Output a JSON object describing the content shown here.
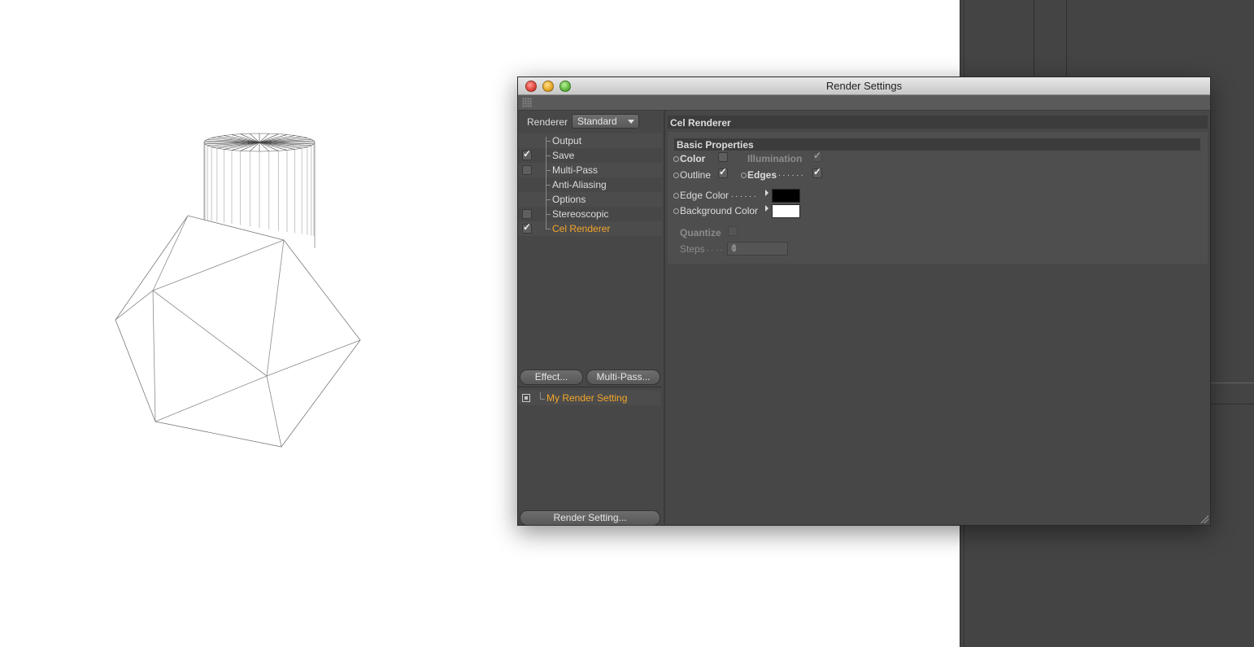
{
  "window": {
    "title": "Render Settings"
  },
  "sidebar": {
    "renderer_label": "Renderer",
    "renderer_value": "Standard",
    "items": [
      {
        "label": "Output",
        "checkbox": false,
        "checked": false,
        "active": false
      },
      {
        "label": "Save",
        "checkbox": true,
        "checked": true,
        "active": false
      },
      {
        "label": "Multi-Pass",
        "checkbox": true,
        "checked": false,
        "active": false
      },
      {
        "label": "Anti-Aliasing",
        "checkbox": false,
        "checked": false,
        "active": false
      },
      {
        "label": "Options",
        "checkbox": false,
        "checked": false,
        "active": false
      },
      {
        "label": "Stereoscopic",
        "checkbox": true,
        "checked": false,
        "active": false
      },
      {
        "label": "Cel Renderer",
        "checkbox": true,
        "checked": true,
        "active": true
      }
    ],
    "effect_button": "Effect...",
    "multipass_button": "Multi-Pass...",
    "render_setting_name": "My Render Setting",
    "render_setting_button": "Render Setting..."
  },
  "content": {
    "section_title": "Cel Renderer",
    "group_title": "Basic Properties",
    "color_label": "Color",
    "color_checked": false,
    "illumination_label": "Illumination",
    "illumination_checked": true,
    "outline_label": "Outline",
    "outline_checked": true,
    "edges_label": "Edges",
    "edges_dots": ". . . . . .",
    "edges_checked": true,
    "edge_color_label": "Edge Color",
    "edge_color_dots": ". . . . . .",
    "edge_color": "#000000",
    "background_color_label": "Background Color",
    "background_color": "#ffffff",
    "quantize_label": "Quantize",
    "quantize_checked": false,
    "steps_label": "Steps",
    "steps_dots": ". . . .",
    "steps_value": "6"
  },
  "colors": {
    "accent": "#f4a62a",
    "panel": "#474747"
  }
}
